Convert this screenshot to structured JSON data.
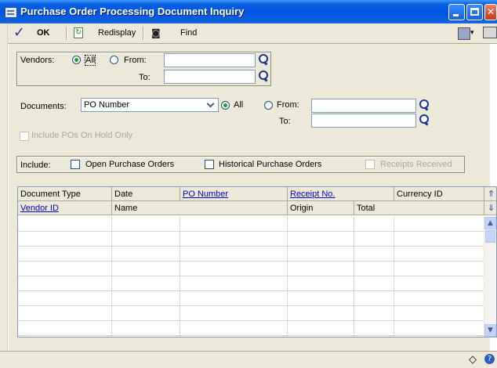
{
  "window": {
    "title": "Purchase Order Processing Document Inquiry"
  },
  "toolbar": {
    "ok": "OK",
    "redisplay": "Redisplay",
    "find": "Find"
  },
  "vendors": {
    "label": "Vendors:",
    "all": "All",
    "from": "From:",
    "to": "To:",
    "from_value": "",
    "to_value": ""
  },
  "documents": {
    "label": "Documents:",
    "selected": "PO Number",
    "all": "All",
    "from": "From:",
    "to": "To:",
    "from_value": "",
    "to_value": ""
  },
  "include_on_hold": "Include POs On Hold Only",
  "include": {
    "label": "Include:",
    "open": "Open Purchase Orders",
    "historical": "Historical Purchase Orders",
    "receipts": "Receipts Received"
  },
  "grid": {
    "row1_headers": [
      "Document Type",
      "Date",
      "PO Number",
      "Receipt No.",
      "Currency ID"
    ],
    "row2_headers": [
      "Vendor ID",
      "Name",
      "Origin",
      "Total"
    ],
    "rows": [
      "",
      "",
      "",
      "",
      "",
      "",
      "",
      ""
    ]
  }
}
